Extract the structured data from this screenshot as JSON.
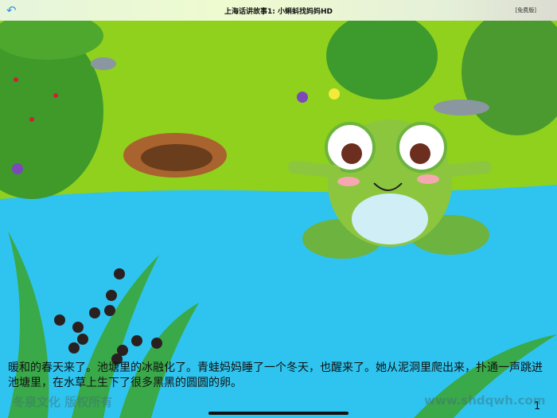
{
  "header": {
    "title": "上海话讲故事1: 小蝌蚪找妈妈HD",
    "badge": "[免费版]",
    "back_icon": "back-arrow-icon"
  },
  "story": {
    "text": "暖和的春天来了。池塘里的冰融化了。青蛙妈妈睡了一个冬天，也醒来了。她从泥洞里爬出来，扑通一声跳进池塘里，在水草上生下了很多黑黑的圆圆的卵。",
    "page_number": "1"
  },
  "watermarks": {
    "left": "冬泉文化 版权所有",
    "right": "www.shdqwh.com"
  },
  "colors": {
    "grass": "#8fd11c",
    "water": "#2ec4ef",
    "frog": "#8cc63f"
  }
}
